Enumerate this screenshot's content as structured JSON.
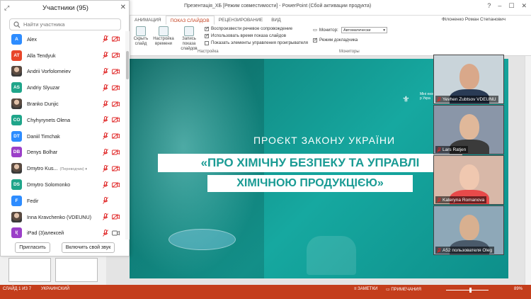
{
  "powerpoint": {
    "title": "Презентація_ХБ [Режим совместимости] - PowerPoint (Сбой активации продукта)",
    "user": "Філоненко Роман Степанович",
    "tabs": [
      {
        "label": "АНИМАЦИЯ",
        "active": false
      },
      {
        "label": "ПОКАЗ СЛАЙДОВ",
        "active": true
      },
      {
        "label": "РЕЦЕНЗИРОВАНИЕ",
        "active": false
      },
      {
        "label": "ВИД",
        "active": false
      }
    ],
    "ribbon": {
      "hide_slide": "Скрыть слайд",
      "rehearse": "Настройка времени",
      "record": "Запись показа слайдов",
      "check_narration": "Воспроизвести речевое сопровождение",
      "check_timings": "Использовать время показа слайдов",
      "check_controls": "Показать элементы управления проигрывателя",
      "group_setup": "Настройка",
      "monitor_label": "Монитор:",
      "monitor_value": "Автоматически",
      "presenter_view": "Режим докладчика",
      "group_monitors": "Мониторы"
    },
    "slide": {
      "subtitle": "ПРОЄКТ ЗАКОНУ УКРАЇНИ",
      "line1": "«ПРО ХІМІЧНУ БЕЗПЕКУ ТА УПРАВЛІ",
      "line2": "ХІМІЧНОЮ ПРОДУКЦІЄЮ»",
      "logo_text": "Міні екон та р Укра"
    },
    "status": {
      "slide_info": "СЛАЙД 1 ИЗ 7",
      "language": "УКРАИНСКИЙ",
      "notes": "ЗАМЕТКИ",
      "comments": "ПРИМЕЧАНИЯ",
      "zoom": "89%"
    }
  },
  "panel": {
    "title": "Участники (95)",
    "search_placeholder": "Найти участника",
    "invite_label": "Пригласить",
    "unmute_label": "Включить свой звук",
    "participants": [
      {
        "initials": "A",
        "name": "Alex",
        "color": "#2d8cff",
        "extra": "",
        "cam": "off"
      },
      {
        "initials": "AT",
        "name": "Alla Tendyuk",
        "color": "#e8462a",
        "extra": "",
        "cam": "off"
      },
      {
        "initials": "",
        "name": "Andrii Vorfolomeiev",
        "color": "#888888",
        "extra": "",
        "cam": "off"
      },
      {
        "initials": "AS",
        "name": "Andriy Slyuzar",
        "color": "#1fa58a",
        "extra": "",
        "cam": "off"
      },
      {
        "initials": "",
        "name": "Branko Dunjic",
        "color": "#888888",
        "extra": "",
        "cam": "off"
      },
      {
        "initials": "CO",
        "name": "Chyhyrynets Olena",
        "color": "#1fa58a",
        "extra": "",
        "cam": "off"
      },
      {
        "initials": "DT",
        "name": "Daniil Timchak",
        "color": "#2d8cff",
        "extra": "",
        "cam": "off"
      },
      {
        "initials": "DB",
        "name": "Denys Bolhar",
        "color": "#9b3fc8",
        "extra": "",
        "cam": "off"
      },
      {
        "initials": "",
        "name": "Dmytro Kus...",
        "color": "#888888",
        "extra": "(Переводчик)",
        "cam": "off"
      },
      {
        "initials": "DS",
        "name": "Dmytro Solomonko",
        "color": "#1fa58a",
        "extra": "",
        "cam": "off"
      },
      {
        "initials": "F",
        "name": "Fedir",
        "color": "#2d8cff",
        "extra": "",
        "cam": "none"
      },
      {
        "initials": "",
        "name": "Inna Kravchenko (VDEUNU)",
        "color": "#888888",
        "extra": "",
        "cam": "off"
      },
      {
        "initials": "I(",
        "name": "iPad (3)алексей",
        "color": "#9b3fc8",
        "extra": "",
        "cam": "on"
      }
    ]
  },
  "videos": [
    {
      "name": "Yevhen Zubtsov VDEUNU",
      "skin": "#d9a88a",
      "bg": "#c9d4da",
      "shirt": "#2a3b55"
    },
    {
      "name": "Lars Ratjen",
      "skin": "#e0b89a",
      "bg": "#8a96a8",
      "shirt": "#3b3b3b"
    },
    {
      "name": "Kateryna Romanova",
      "skin": "#f0c8b0",
      "bg": "#d8b8a8",
      "shirt": "#e84a4a"
    },
    {
      "name": "A52 пользователя Oleg",
      "skin": "#d8b090",
      "bg": "#8ea8b8",
      "shirt": "#4a5a6a"
    }
  ]
}
